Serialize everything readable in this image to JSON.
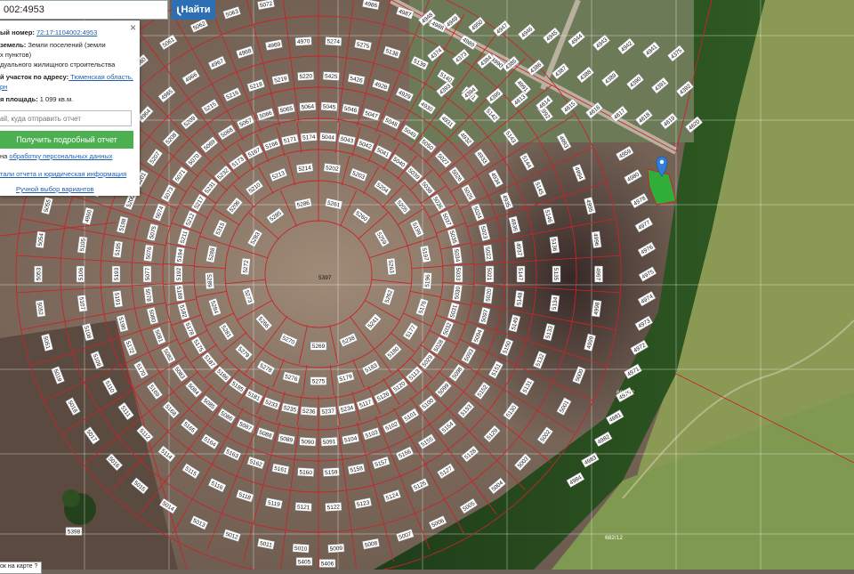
{
  "search": {
    "value": "002:4953",
    "button_label": "Найти"
  },
  "info": {
    "cadastral_label": "ый номер:",
    "cadastral_value": "72:17:1104002:4953",
    "land_label": "земель:",
    "land_value_1": " Земли поселений (земли",
    "land_value_2": "х пунктов)",
    "use_value": "дуального жилищного строительства",
    "address_label": "й участок по адресу:",
    "address_value_1": " Тюменская область,",
    "address_value_2": "рн",
    "area_label": "я площадь:",
    "area_value": " 1 099 кв.м.",
    "email_placeholder": "ail, куда отправить отчет",
    "report_button": "Получить подробный отчет",
    "consent_prefix": "на ",
    "consent_link": "обработку персональных данных",
    "details_link": "тали отчета и юридическая информация",
    "manual_link": "Ручной выбор вариантов"
  },
  "bottom_tab": "ок на карте ?",
  "colors": {
    "parcel_border": "#c8242a",
    "selected_parcel": "#2fae3a",
    "marker": "#2f7fd6",
    "button_green": "#4caf50",
    "button_blue": "#2d6fb4"
  },
  "map": {
    "center_parcel": "5397",
    "selected_parcel": "4953",
    "rings": [
      {
        "labels": [
          "5261",
          "5260",
          "5259",
          "5263",
          "5262",
          "5241",
          "5238",
          "5269",
          "5270",
          "5266",
          "5273",
          "5272",
          "5283",
          "5285",
          "5286"
        ]
      },
      {
        "labels": [
          "5202",
          "5203",
          "5204",
          "5205",
          "5199",
          "5197",
          "5196",
          "5176",
          "5177",
          "5180",
          "5183",
          "5179",
          "5275",
          "5276",
          "5278",
          "5279",
          "5281",
          "5284",
          "5289",
          "5288",
          "5315",
          "5206",
          "5210",
          "5213",
          "5214"
        ]
      },
      {
        "labels": [
          "5044",
          "5043",
          "5042",
          "5041",
          "5040",
          "5039",
          "5038",
          "5036",
          "5037",
          "5035",
          "5034",
          "5033",
          "5030",
          "5031",
          "5032",
          "5028",
          "5029",
          "5113",
          "5120",
          "5126",
          "5117",
          "5234",
          "5237",
          "5236",
          "5235",
          "5233",
          "5181",
          "5185",
          "5186",
          "5187",
          "5175",
          "5178",
          "5182",
          "5188",
          "5192",
          "5194",
          "5211",
          "5212",
          "5217",
          "5231",
          "5232",
          "5173",
          "5167",
          "5166",
          "5171",
          "5174"
        ]
      },
      {
        "labels": [
          "5045",
          "5046",
          "5047",
          "5048",
          "5049",
          "5050",
          "5027",
          "5026",
          "5025",
          "5024",
          "5023",
          "5022",
          "5021",
          "5020",
          "5097",
          "5094",
          "5093",
          "5098",
          "5099",
          "5100",
          "5101",
          "5102",
          "5103",
          "5104",
          "5091",
          "5090",
          "5089",
          "5088",
          "5087",
          "5086",
          "5085",
          "5084",
          "5083",
          "5082",
          "5081",
          "5080",
          "5078",
          "5077",
          "5076",
          "5075",
          "5074",
          "5073",
          "5071",
          "5070",
          "5069",
          "5068",
          "5067",
          "5066",
          "5065",
          "5064"
        ]
      },
      {
        "labels": [
          "5425",
          "5426",
          "4928",
          "4929",
          "4930",
          "4931",
          "4932",
          "4933",
          "4934",
          "4935",
          "4936",
          "4937",
          "5147",
          "5148",
          "5149",
          "5150",
          "5151",
          "5152",
          "5153",
          "5154",
          "5155",
          "5156",
          "5157",
          "5158",
          "5159",
          "5160",
          "5161",
          "5162",
          "5163",
          "5164",
          "5165",
          "5168",
          "5169",
          "5170",
          "5172",
          "5190",
          "5191",
          "5193",
          "5195",
          "5198",
          "5200",
          "5201",
          "5207",
          "5208",
          "5209",
          "5215",
          "5216",
          "5218",
          "5219",
          "5220"
        ]
      },
      {
        "labels": [
          "5274",
          "5275",
          "5138",
          "5139",
          "5140",
          "5141",
          "5142",
          "5143",
          "5144",
          "5145",
          "5146",
          "5136",
          "5135",
          "5134",
          "5133",
          "5132",
          "5131",
          "5130",
          "5129",
          "5128",
          "5127",
          "5125",
          "5124",
          "5123",
          "5122",
          "5121",
          "5119",
          "5118",
          "5116",
          "5115",
          "5114",
          "5112",
          "5111",
          "5110",
          "5109",
          "5108",
          "5107",
          "5106",
          "5105",
          "4960",
          "4961",
          "4962",
          "4963",
          "4964",
          "4965",
          "4966",
          "4967",
          "4968",
          "4969",
          "4970"
        ]
      },
      {
        "labels": [
          "4985",
          "4986",
          "4987",
          "4988",
          "4989",
          "4990",
          "4991",
          "4992",
          "4993",
          "4994",
          "4995",
          "4996",
          "4997",
          "4998",
          "4999",
          "5000",
          "5001",
          "5002",
          "5003",
          "5004",
          "5005",
          "5006",
          "5007",
          "5008",
          "5009",
          "5010",
          "5011",
          "5012",
          "5013",
          "5014",
          "5015",
          "5016",
          "5017",
          "5018",
          "5019",
          "5051",
          "5052",
          "5053",
          "5054",
          "5055",
          "5056",
          "5057",
          "5058",
          "5059",
          "5060",
          "5061",
          "5062",
          "5063",
          "5072",
          "5079"
        ]
      }
    ],
    "east_column": [
      "4951",
      "4952",
      "4954",
      "4955",
      "4956",
      "4957",
      "4958",
      "4959",
      "4980",
      "4978",
      "4977",
      "4976",
      "4975",
      "4974",
      "4973",
      "4972",
      "4971",
      "4979",
      "4981",
      "4982",
      "4983",
      "4984"
    ],
    "north_labels": [
      "4948",
      "4949",
      "4950",
      "4947",
      "4946",
      "4945",
      "4944",
      "4943",
      "4942",
      "4941",
      "4375",
      "4374",
      "4373",
      "4384",
      "4385",
      "4386",
      "4387",
      "4388",
      "4389",
      "4390",
      "4391",
      "4392",
      "4393",
      "4394",
      "4395",
      "4613",
      "4614",
      "4615",
      "4616",
      "4617",
      "4618",
      "4619",
      "4620"
    ],
    "road_labels": [
      "682/12",
      "682/12"
    ],
    "other_labels": [
      "5398",
      "5405",
      "5406"
    ]
  }
}
